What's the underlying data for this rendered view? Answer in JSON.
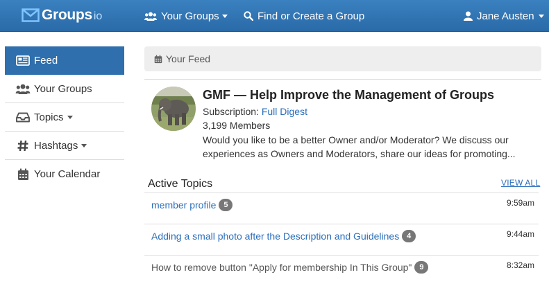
{
  "header": {
    "brand": "Groups",
    "brand_suffix": "io",
    "your_groups": "Your Groups",
    "find_create": "Find or Create a Group",
    "user": "Jane Austen"
  },
  "sidebar": {
    "items": [
      {
        "label": "Feed",
        "icon": "newspaper-icon",
        "active": true
      },
      {
        "label": "Your Groups",
        "icon": "users-icon"
      },
      {
        "label": "Topics",
        "icon": "inbox-icon",
        "dropdown": true
      },
      {
        "label": "Hashtags",
        "icon": "hashtag-icon",
        "dropdown": true
      },
      {
        "label": "Your Calendar",
        "icon": "calendar-icon"
      }
    ]
  },
  "feed": {
    "title": "Your Feed"
  },
  "group": {
    "name": "GMF — Help Improve the Management of Groups",
    "subscription_label": "Subscription:",
    "subscription_value": "Full Digest",
    "members": "3,199 Members",
    "description": "Would you like to be a better Owner and/or Moderator? We discuss our experiences as Owners and Moderators, share our ideas for promoting..."
  },
  "topics": {
    "heading": "Active Topics",
    "view_all": "VIEW ALL",
    "items": [
      {
        "title": "member profile",
        "count": "5",
        "time": "9:59am"
      },
      {
        "title": "Adding a small photo after the Description and Guidelines",
        "count": "4",
        "time": "9:44am"
      },
      {
        "title": "How to remove button \"Apply for membership In This Group\"",
        "count": "9",
        "time": "8:32am"
      }
    ]
  },
  "colors": {
    "nav_bg": "#2f74b5",
    "active_sidebar": "#2f6fad",
    "link": "#2a6ebb",
    "badge": "#777777"
  }
}
